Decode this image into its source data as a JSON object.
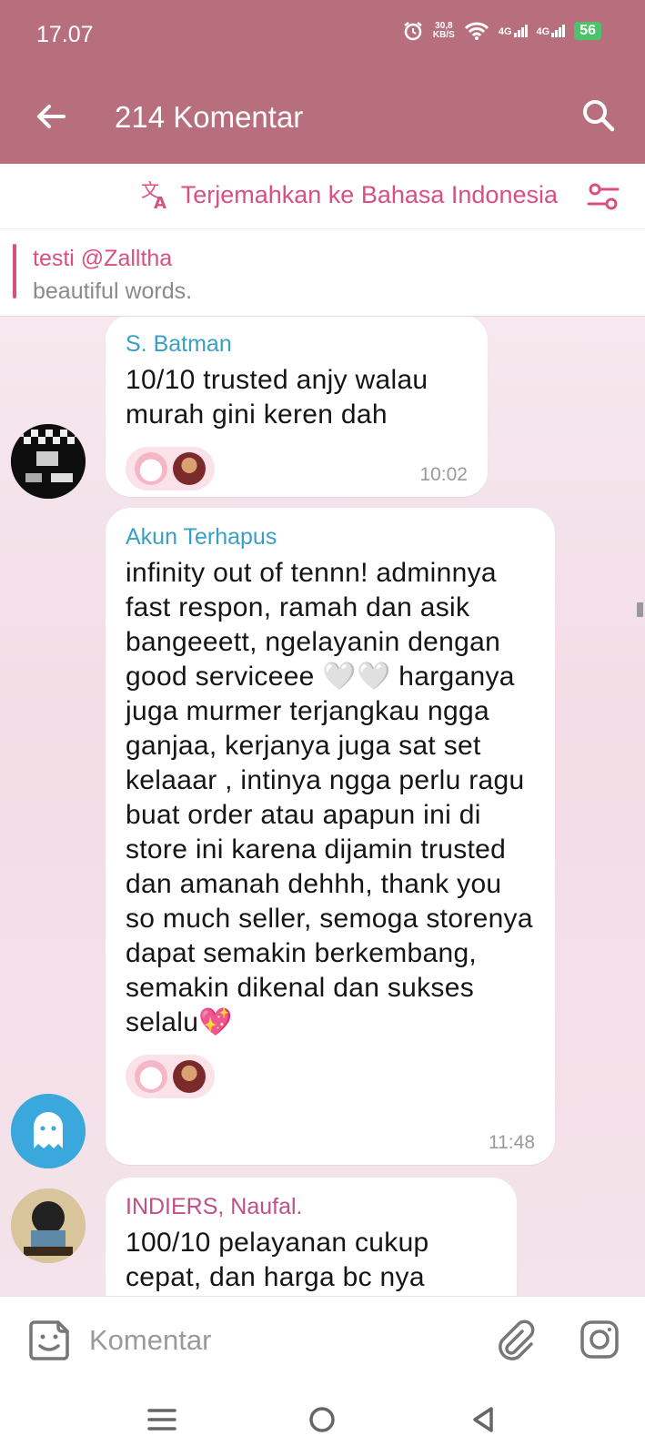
{
  "status": {
    "time": "17.07",
    "speed_value": "30,8",
    "speed_unit": "KB/S",
    "net1": "4G",
    "net2": "4G",
    "battery": "56",
    "icons": [
      "alarm-icon",
      "wifi-icon",
      "signal-icon",
      "battery-icon"
    ]
  },
  "header": {
    "title": "214 Komentar"
  },
  "translate": {
    "label": "Terjemahkan ke Bahasa Indonesia"
  },
  "pinned": {
    "title": "testi @Zalltha",
    "text": "beautiful words."
  },
  "messages": [
    {
      "author": "S. Batman",
      "author_color": "#3a9fc4",
      "text": "10/10 trusted anjy walau murah gini keren dah",
      "time": "10:02"
    },
    {
      "author": "Akun Terhapus",
      "author_color": "#3a9fc4",
      "text": "infinity out of tennn! adminnya fast respon, ramah dan asik bangeeett, ngelayanin dengan good serviceee 🤍🤍 harganya juga murmer terjangkau ngga ganjaa, kerjanya juga sat set kelaaar , intinya ngga perlu ragu buat order atau apapun ini di store ini karena dijamin trusted dan amanah dehhh, thank you so much seller, semoga storenya dapat semakin berkembang, semakin dikenal dan sukses selalu💖",
      "time": "11:48"
    },
    {
      "author": "INDIERS, Naufal.",
      "author_color": "#c0508a",
      "text": "100/10 pelayanan cukup cepat, dan harga bc nya",
      "time": ""
    }
  ],
  "composer": {
    "placeholder": "Komentar"
  },
  "colors": {
    "header": "#b86f7d",
    "accent": "#d94f80",
    "chat_bg": "#f4e4ea"
  }
}
